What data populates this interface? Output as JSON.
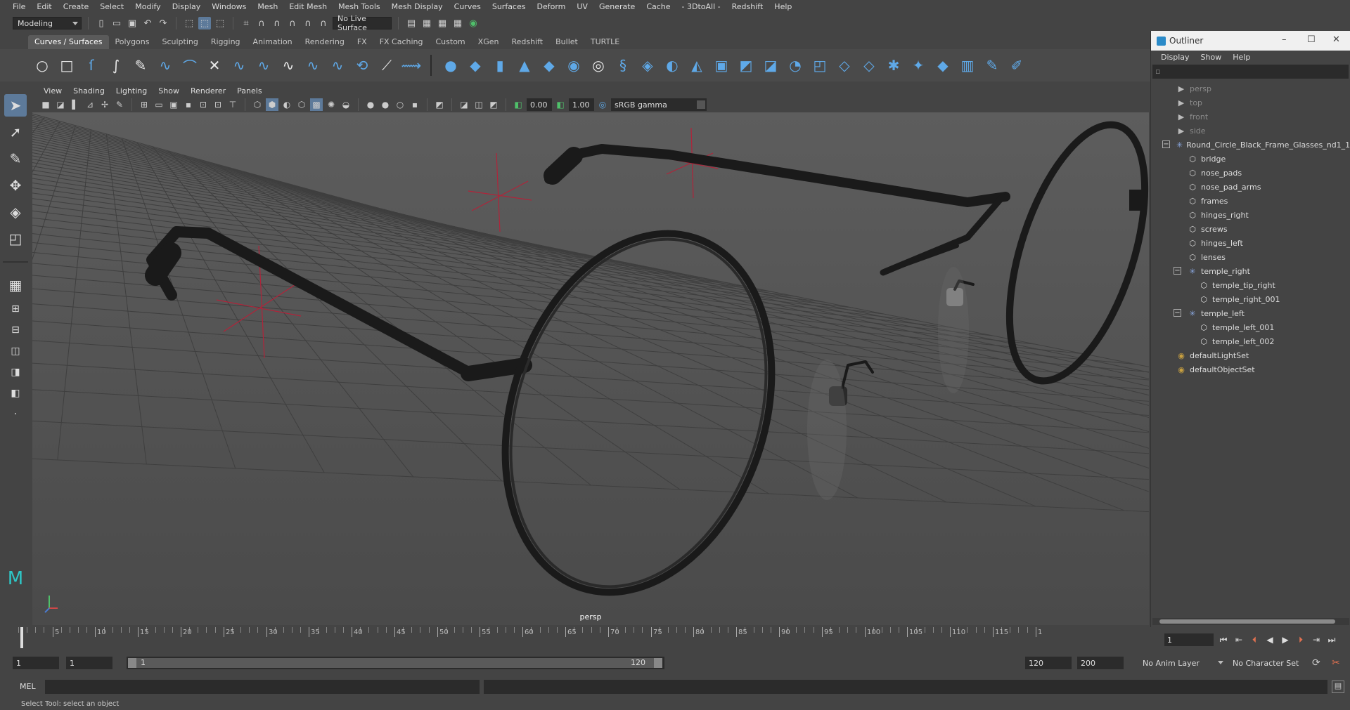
{
  "menubar": [
    "File",
    "Edit",
    "Create",
    "Select",
    "Modify",
    "Display",
    "Windows",
    "Mesh",
    "Edit Mesh",
    "Mesh Tools",
    "Mesh Display",
    "Curves",
    "Surfaces",
    "Deform",
    "UV",
    "Generate",
    "Cache",
    "- 3DtoAll -",
    "Redshift",
    "Help"
  ],
  "statusline": {
    "menuset": "Modeling",
    "live_surface": "No Live Surface"
  },
  "shelf": {
    "tabs": [
      "Curves / Surfaces",
      "Polygons",
      "Sculpting",
      "Rigging",
      "Animation",
      "Rendering",
      "FX",
      "FX Caching",
      "Custom",
      "XGen",
      "Redshift",
      "Bullet",
      "TURTLE"
    ],
    "active_tab": "Curves / Surfaces"
  },
  "viewport": {
    "menu": [
      "View",
      "Shading",
      "Lighting",
      "Show",
      "Renderer",
      "Panels"
    ],
    "exposure": "0.00",
    "gamma": "1.00",
    "color_space": "sRGB gamma",
    "camera_label": "persp"
  },
  "outliner": {
    "title": "Outliner",
    "menu": [
      "Display",
      "Show",
      "Help"
    ],
    "items": [
      {
        "label": "persp",
        "icon": "camera-icon",
        "level": 0,
        "dim": true
      },
      {
        "label": "top",
        "icon": "camera-icon",
        "level": 0,
        "dim": true
      },
      {
        "label": "front",
        "icon": "camera-icon",
        "level": 0,
        "dim": true
      },
      {
        "label": "side",
        "icon": "camera-icon",
        "level": 0,
        "dim": true
      },
      {
        "label": "Round_Circle_Black_Frame_Glasses_nd1_1",
        "icon": "group-icon",
        "level": 0,
        "expanded": true
      },
      {
        "label": "bridge",
        "icon": "mesh-icon",
        "level": 1
      },
      {
        "label": "nose_pads",
        "icon": "mesh-icon",
        "level": 1
      },
      {
        "label": "nose_pad_arms",
        "icon": "mesh-icon",
        "level": 1
      },
      {
        "label": "frames",
        "icon": "mesh-icon",
        "level": 1
      },
      {
        "label": "hinges_right",
        "icon": "mesh-icon",
        "level": 1
      },
      {
        "label": "screws",
        "icon": "mesh-icon",
        "level": 1
      },
      {
        "label": "hinges_left",
        "icon": "mesh-icon",
        "level": 1
      },
      {
        "label": "lenses",
        "icon": "mesh-icon",
        "level": 1
      },
      {
        "label": "temple_right",
        "icon": "group-icon",
        "level": 1,
        "expanded": true
      },
      {
        "label": "temple_tip_right",
        "icon": "mesh-icon",
        "level": 2
      },
      {
        "label": "temple_right_001",
        "icon": "mesh-icon",
        "level": 2
      },
      {
        "label": "temple_left",
        "icon": "group-icon",
        "level": 1,
        "expanded": true
      },
      {
        "label": "temple_left_001",
        "icon": "mesh-icon",
        "level": 2
      },
      {
        "label": "temple_left_002",
        "icon": "mesh-icon",
        "level": 2
      },
      {
        "label": "defaultLightSet",
        "icon": "set-icon",
        "level": 0
      },
      {
        "label": "defaultObjectSet",
        "icon": "set-icon",
        "level": 0
      }
    ]
  },
  "timeslider": {
    "labels": [
      "5",
      "10",
      "15",
      "20",
      "25",
      "30",
      "35",
      "40",
      "45",
      "50",
      "55",
      "60",
      "65",
      "70",
      "75",
      "80",
      "85",
      "90",
      "95",
      "100",
      "105",
      "110",
      "115",
      "1"
    ],
    "current_frame": "1"
  },
  "range": {
    "start": "1",
    "start_inner": "1",
    "range_start_label": "1",
    "range_end_label": "120",
    "end_inner": "120",
    "end": "200",
    "anim_layer": "No Anim Layer",
    "character_set": "No Character Set"
  },
  "cmdline": {
    "label": "MEL"
  },
  "helpline": "Select Tool: select an object",
  "colors": {
    "accent": "#5d7a9a",
    "shelf_blue": "#5fa9e8",
    "locator_red": "#b0243a"
  }
}
